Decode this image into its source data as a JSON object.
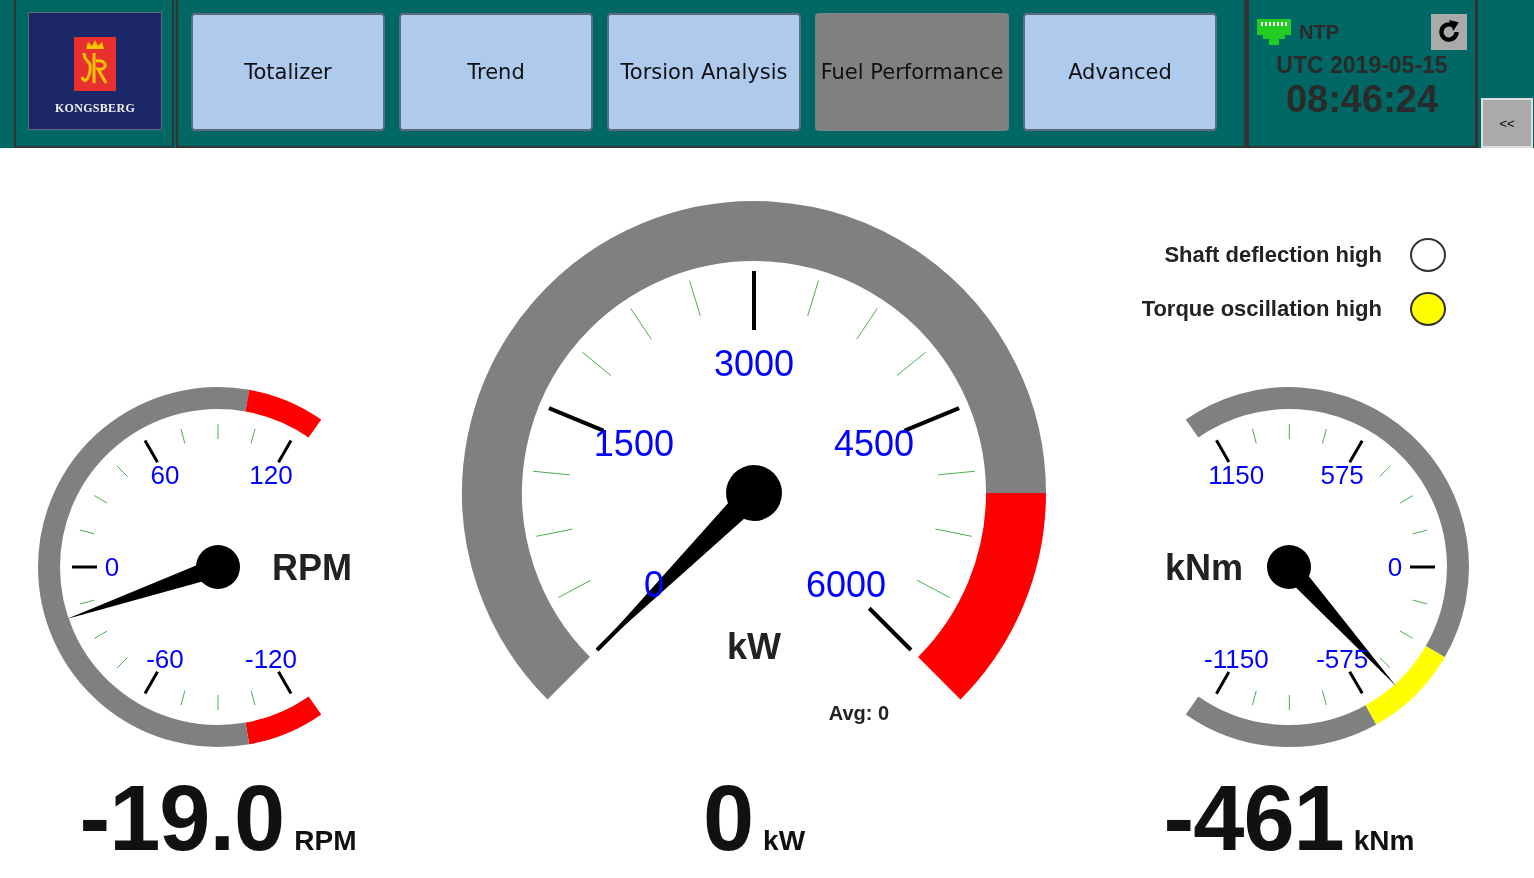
{
  "header": {
    "logo": {
      "text": "KONGSBERG"
    },
    "nav": [
      {
        "label": "Totalizer",
        "selected": false
      },
      {
        "label": "Trend",
        "selected": false
      },
      {
        "label": "Torsion Analysis",
        "selected": false
      },
      {
        "label": "Fuel Performance",
        "selected": true
      },
      {
        "label": "Advanced",
        "selected": false
      }
    ],
    "clock": {
      "source": "NTP",
      "date": "UTC 2019-05-15",
      "time": "08:46:24"
    },
    "collapse_button": "<<"
  },
  "alarms": [
    {
      "label": "Shaft deflection high",
      "color": "#ffffff"
    },
    {
      "label": "Torque oscillation high",
      "color": "#ffff00"
    }
  ],
  "gauges": [
    {
      "kind": "left",
      "unit": "RPM",
      "segments": [
        {
          "color": "#ff0000"
        },
        {
          "color": "#808080"
        },
        {
          "color": "#ff0000"
        }
      ],
      "ticks": [
        "-120",
        "-60",
        "0",
        "60",
        "120"
      ],
      "readout": {
        "value": "-19.0",
        "unit": "RPM"
      }
    },
    {
      "kind": "center",
      "unit": "kW",
      "note": "Avg: 0",
      "segments": [
        {
          "color": "#808080"
        },
        {
          "color": "#ff0000"
        }
      ],
      "ticks": [
        "0",
        "1500",
        "3000",
        "4500",
        "6000"
      ],
      "readout": {
        "value": "0",
        "unit": "kW"
      }
    },
    {
      "kind": "right",
      "unit": "kNm",
      "segments": [
        {
          "color": "#808080"
        },
        {
          "color": "#ffff00"
        },
        {
          "color": "#808080"
        }
      ],
      "ticks": [
        "-1150",
        "-575",
        "0",
        "575",
        "1150"
      ],
      "readout": {
        "value": "-461",
        "unit": "kNm"
      }
    }
  ]
}
